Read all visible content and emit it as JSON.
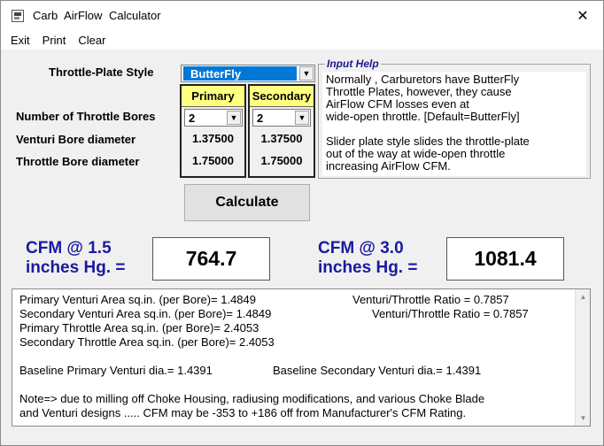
{
  "window": {
    "title": "Carb  AirFlow  Calculator",
    "close_glyph": "✕"
  },
  "menu": [
    "Exit",
    "Print",
    "Clear"
  ],
  "form": {
    "throttle_plate_label": "Throttle-Plate Style",
    "throttle_plate_value": "ButterFly",
    "primary_header": "Primary",
    "secondary_header": "Secondary",
    "bores_label": "Number of Throttle Bores",
    "primary_bores": "2",
    "secondary_bores": "2",
    "venturi_label": "Venturi Bore  diameter",
    "primary_venturi": "1.37500",
    "secondary_venturi": "1.37500",
    "throttle_label": "Throttle Bore  diameter",
    "primary_throttle": "1.75000",
    "secondary_throttle": "1.75000"
  },
  "help": {
    "legend": "Input Help",
    "line1": "Normally ,  Carburetors have ButterFly",
    "line2": "Throttle Plates, however, they cause",
    "line3": "AirFlow CFM losses even at",
    "line4": "wide-open throttle.   [Default=ButterFly]",
    "line5": "Slider plate style slides the throttle-plate",
    "line6": "out of the way at wide-open throttle",
    "line7": "increasing AirFlow CFM."
  },
  "calculate_label": "Calculate",
  "cfm1": {
    "label_line1": "CFM @ 1.5",
    "label_line2": "inches Hg. =",
    "value": "764.7"
  },
  "cfm2": {
    "label_line1": "CFM @ 3.0",
    "label_line2": "inches Hg. =",
    "value": "1081.4"
  },
  "results": {
    "primary_area": "Primary Venturi Area sq.in. (per Bore)= 1.4849",
    "primary_ratio": "Venturi/Throttle Ratio = 0.7857",
    "secondary_area": "Secondary Venturi Area sq.in. (per Bore)= 1.4849",
    "secondary_ratio": "Venturi/Throttle Ratio = 0.7857",
    "primary_throttle_area": "Primary Throttle Area sq.in. (per Bore)= 2.4053",
    "secondary_throttle_area": "Secondary Throttle Area sq.in. (per Bore)= 2.4053",
    "baseline_primary": "Baseline Primary Venturi dia.= 1.4391",
    "baseline_secondary": "Baseline Secondary Venturi dia.= 1.4391",
    "note1": "Note=> due to milling off Choke Housing, radiusing modifications, and various Choke Blade",
    "note2": "and Venturi designs ..... CFM may be -353 to +186 off from Manufacturer's CFM Rating."
  }
}
